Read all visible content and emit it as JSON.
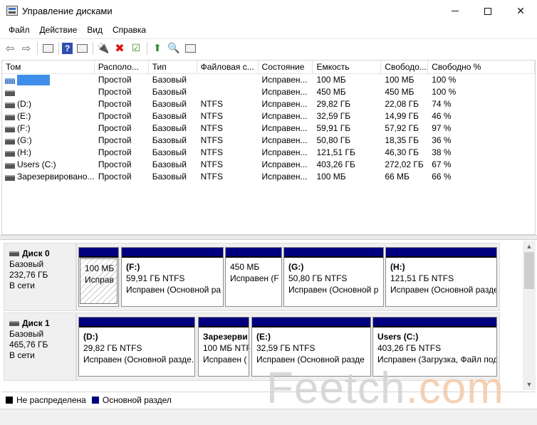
{
  "window": {
    "title": "Управление дисками",
    "minimize_glyph": "—",
    "close_glyph": "✕"
  },
  "menu": [
    "Файл",
    "Действие",
    "Вид",
    "Справка"
  ],
  "toolbar_icons": [
    "back-icon",
    "forward-icon",
    "console-tree-icon",
    "help-icon",
    "properties-icon",
    "connect-disk-icon",
    "delete-icon",
    "check-icon",
    "up-folder-icon",
    "search-folder-icon",
    "settings-list-icon"
  ],
  "list": {
    "columns": [
      "Том",
      "Располо...",
      "Тип",
      "Файловая с...",
      "Состояние",
      "Емкость",
      "Свободо...",
      "Свободно %"
    ],
    "rows": [
      [
        "",
        "Простой",
        "Базовый",
        "",
        "Исправен...",
        "100 МБ",
        "100 МБ",
        "100 %"
      ],
      [
        "",
        "Простой",
        "Базовый",
        "",
        "Исправен...",
        "450 МБ",
        "450 МБ",
        "100 %"
      ],
      [
        "(D:)",
        "Простой",
        "Базовый",
        "NTFS",
        "Исправен...",
        "29,82 ГБ",
        "22,08 ГБ",
        "74 %"
      ],
      [
        "(E:)",
        "Простой",
        "Базовый",
        "NTFS",
        "Исправен...",
        "32,59 ГБ",
        "14,99 ГБ",
        "46 %"
      ],
      [
        "(F:)",
        "Простой",
        "Базовый",
        "NTFS",
        "Исправен...",
        "59,91 ГБ",
        "57,92 ГБ",
        "97 %"
      ],
      [
        "(G:)",
        "Простой",
        "Базовый",
        "NTFS",
        "Исправен...",
        "50,80 ГБ",
        "18,35 ГБ",
        "36 %"
      ],
      [
        "(H:)",
        "Простой",
        "Базовый",
        "NTFS",
        "Исправен...",
        "121,51 ГБ",
        "46,30 ГБ",
        "38 %"
      ],
      [
        "Users (C:)",
        "Простой",
        "Базовый",
        "NTFS",
        "Исправен...",
        "403,26 ГБ",
        "272,02 ГБ",
        "67 %"
      ],
      [
        "Зарезервировано...",
        "Простой",
        "Базовый",
        "NTFS",
        "Исправен...",
        "100 МБ",
        "66 МБ",
        "66 %"
      ]
    ]
  },
  "disks": [
    {
      "title": "Диск 0",
      "type": "Базовый",
      "size": "232,76 ГБ",
      "status": "В сети",
      "partitions": [
        {
          "name": "",
          "size": "100 МБ",
          "state": "Исправ",
          "hatched": true
        },
        {
          "name": "(F:)",
          "size": "59,91 ГБ NTFS",
          "state": "Исправен (Основной ра",
          "hatched": false
        },
        {
          "name": "",
          "size": "450 МБ",
          "state": "Исправен (F",
          "hatched": false
        },
        {
          "name": "(G:)",
          "size": "50,80 ГБ NTFS",
          "state": "Исправен (Основной р",
          "hatched": false
        },
        {
          "name": "(H:)",
          "size": "121,51 ГБ NTFS",
          "state": "Исправен (Основной разде",
          "hatched": false
        }
      ]
    },
    {
      "title": "Диск 1",
      "type": "Базовый",
      "size": "465,76 ГБ",
      "status": "В сети",
      "partitions": [
        {
          "name": "(D:)",
          "size": "29,82 ГБ NTFS",
          "state": "Исправен (Основной разде..",
          "hatched": false
        },
        {
          "name": "Зарезерви",
          "size": "100 МБ NTFS",
          "state": "Исправен (",
          "hatched": false
        },
        {
          "name": "(E:)",
          "size": "32,59 ГБ NTFS",
          "state": "Исправен (Основной разде",
          "hatched": false
        },
        {
          "name": "Users (C:)",
          "size": "403,26 ГБ NTFS",
          "state": "Исправен (Загрузка, Файл подкачки",
          "hatched": false
        }
      ]
    }
  ],
  "legend": [
    {
      "label": "Не распределена",
      "color": "#000000"
    },
    {
      "label": "Основной раздел",
      "color": "#00007f"
    }
  ],
  "watermark": {
    "main": "Feetch",
    "accent": ".com"
  }
}
